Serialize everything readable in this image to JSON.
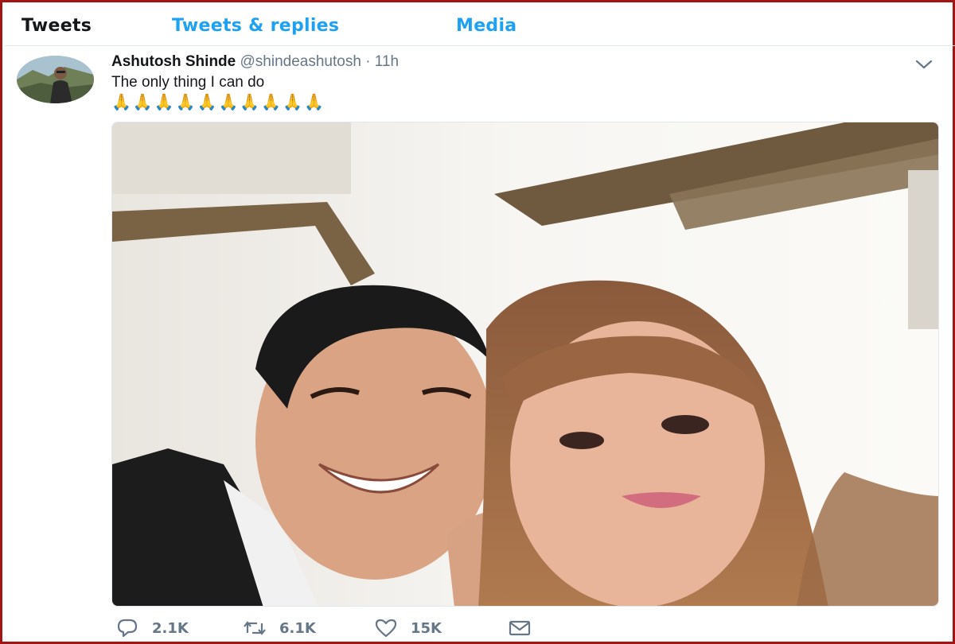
{
  "tabs": [
    {
      "label": "Tweets",
      "active": true
    },
    {
      "label": "Tweets & replies",
      "active": false
    },
    {
      "label": "Media",
      "active": false
    }
  ],
  "tweet": {
    "display_name": "Ashutosh Shinde",
    "handle": "@shindeashutosh",
    "separator": "·",
    "time": "11h",
    "text": "The only thing I can do",
    "emoji": "🙏🙏🙏🙏🙏🙏🙏🙏🙏🙏",
    "actions": {
      "replies": "2.1K",
      "retweets": "6.1K",
      "likes": "15K"
    }
  },
  "colors": {
    "accent": "#1da1f2",
    "frame_border": "#a31515",
    "muted": "#657786"
  },
  "icons": {
    "caret": "chevron-down-icon",
    "reply": "reply-icon",
    "retweet": "retweet-icon",
    "like": "heart-icon",
    "message": "envelope-icon"
  }
}
